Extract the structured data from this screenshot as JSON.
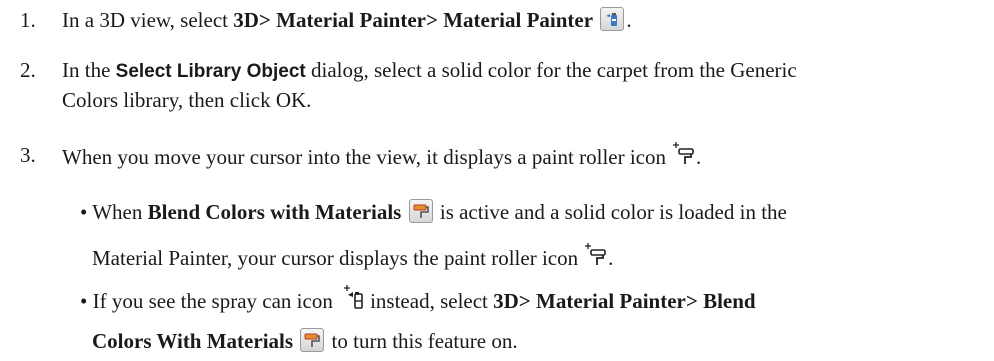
{
  "steps": [
    {
      "number": "1.",
      "pre": "In a 3D view, select ",
      "menu": "3D> Material Painter> Material Painter",
      "post": "."
    },
    {
      "number": "2.",
      "pre": "In the ",
      "dialog": "Select Library Object",
      "line1_post": " dialog, select a solid color for the carpet from the Generic",
      "line2": "Colors library, then click OK."
    },
    {
      "number": "3.",
      "text": "When you move your cursor into the view, it displays a paint roller icon",
      "post": "."
    }
  ],
  "bullets": [
    {
      "pre": "• When ",
      "bold": "Blend Colors with Materials",
      "line1_post": " is active and a solid color is loaded in the",
      "line2": "Material Painter, your cursor displays the paint roller icon",
      "line2_post": "."
    },
    {
      "pre": "• If you see the spray can icon",
      "mid": " instead, select ",
      "bold1": "3D> Material Painter> Blend",
      "bold2": "Colors With Materials",
      "post": " to turn this feature on."
    }
  ],
  "icons": {
    "material_painter": "spray-can-icon",
    "paint_roller_cursor": "paint-roller-cursor-icon",
    "blend_colors": "paint-roller-icon",
    "spray_can_cursor": "spray-can-cursor-icon"
  },
  "colors": {
    "text": "#1a1a1a",
    "spray_blue": "#3a78c8",
    "roller_orange": "#e0902a",
    "roller_red": "#c0392b"
  }
}
